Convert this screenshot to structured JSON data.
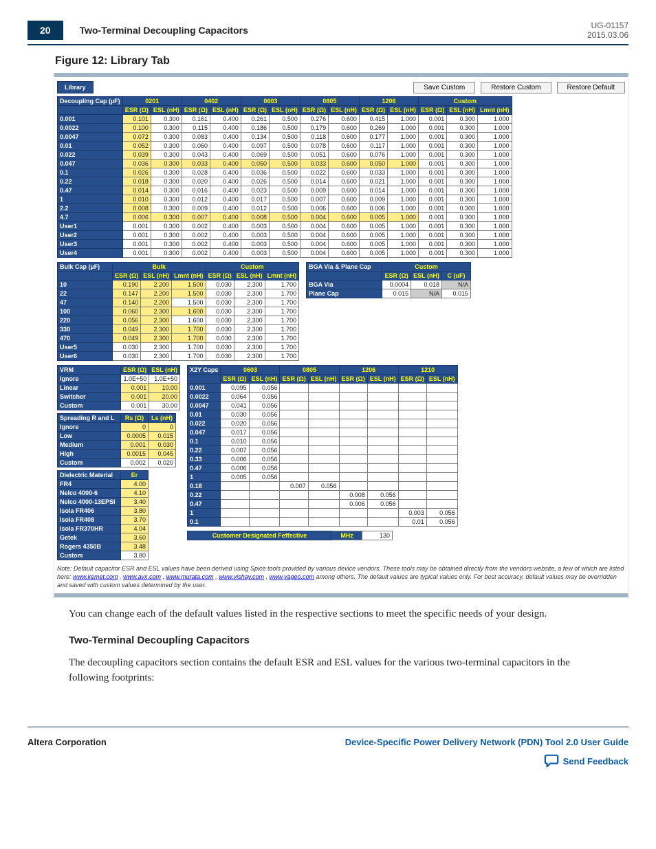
{
  "doc": {
    "id": "UG-01157",
    "date": "2015.03.06",
    "page": "20"
  },
  "header": {
    "section": "Two-Terminal Decoupling Capacitors"
  },
  "figure": {
    "caption": "Figure 12: Library Tab",
    "tab": "Library",
    "buttons": {
      "save": "Save Custom",
      "restore": "Restore Custom",
      "default": "Restore Default"
    }
  },
  "decoupling": {
    "title": "Decoupling Cap (µF)",
    "groups": [
      "0201",
      "0402",
      "0603",
      "0805",
      "1206",
      "Custom"
    ],
    "cols": [
      "ESR (Ω)",
      "ESL (nH)",
      "ESR (Ω)",
      "ESL (nH)",
      "ESR (Ω)",
      "ESL (nH)",
      "ESR (Ω)",
      "ESL (nH)",
      "ESR (Ω)",
      "ESL (nH)",
      "ESR (Ω)",
      "ESL (nH)",
      "Lmnt (nH)"
    ],
    "rows": [
      {
        "label": "0.001",
        "hl": [
          0
        ],
        "v": [
          "0.101",
          "0.300",
          "0.161",
          "0.400",
          "0.261",
          "0.500",
          "0.276",
          "0.600",
          "0.415",
          "1.000",
          "0.001",
          "0.300",
          "1.000"
        ]
      },
      {
        "label": "0.0022",
        "hl": [
          0
        ],
        "v": [
          "0.100",
          "0.300",
          "0.115",
          "0.400",
          "0.186",
          "0.500",
          "0.179",
          "0.600",
          "0.269",
          "1.000",
          "0.001",
          "0.300",
          "1.000"
        ]
      },
      {
        "label": "0.0047",
        "hl": [
          0
        ],
        "v": [
          "0.072",
          "0.300",
          "0.083",
          "0.400",
          "0.134",
          "0.500",
          "0.118",
          "0.600",
          "0.177",
          "1.000",
          "0.001",
          "0.300",
          "1.000"
        ]
      },
      {
        "label": "0.01",
        "hl": [
          0
        ],
        "v": [
          "0.052",
          "0.300",
          "0.060",
          "0.400",
          "0.097",
          "0.500",
          "0.078",
          "0.600",
          "0.117",
          "1.000",
          "0.001",
          "0.300",
          "1.000"
        ]
      },
      {
        "label": "0.022",
        "hl": [
          0
        ],
        "v": [
          "0.039",
          "0.300",
          "0.043",
          "0.400",
          "0.069",
          "0.500",
          "0.051",
          "0.600",
          "0.076",
          "1.000",
          "0.001",
          "0.300",
          "1.000"
        ]
      },
      {
        "label": "0.047",
        "hl": [
          0,
          1,
          2,
          3,
          4,
          5,
          6,
          7,
          8,
          9
        ],
        "v": [
          "0.036",
          "0.300",
          "0.033",
          "0.400",
          "0.050",
          "0.500",
          "0.033",
          "0.600",
          "0.050",
          "1.000",
          "0.001",
          "0.300",
          "1.000"
        ]
      },
      {
        "label": "0.1",
        "hl": [
          0
        ],
        "v": [
          "0.026",
          "0.300",
          "0.028",
          "0.400",
          "0.036",
          "0.500",
          "0.022",
          "0.600",
          "0.033",
          "1.000",
          "0.001",
          "0.300",
          "1.000"
        ]
      },
      {
        "label": "0.22",
        "hl": [
          0
        ],
        "v": [
          "0.018",
          "0.300",
          "0.020",
          "0.400",
          "0.026",
          "0.500",
          "0.014",
          "0.600",
          "0.021",
          "1.000",
          "0.001",
          "0.300",
          "1.000"
        ]
      },
      {
        "label": "0.47",
        "hl": [
          0
        ],
        "v": [
          "0.014",
          "0.300",
          "0.016",
          "0.400",
          "0.023",
          "0.500",
          "0.009",
          "0.600",
          "0.014",
          "1.000",
          "0.001",
          "0.300",
          "1.000"
        ]
      },
      {
        "label": "1",
        "hl": [
          0
        ],
        "v": [
          "0.010",
          "0.300",
          "0.012",
          "0.400",
          "0.017",
          "0.500",
          "0.007",
          "0.600",
          "0.009",
          "1.000",
          "0.001",
          "0.300",
          "1.000"
        ]
      },
      {
        "label": "2.2",
        "hl": [
          0
        ],
        "v": [
          "0.008",
          "0.300",
          "0.009",
          "0.400",
          "0.012",
          "0.500",
          "0.006",
          "0.600",
          "0.006",
          "1.000",
          "0.001",
          "0.300",
          "1.000"
        ]
      },
      {
        "label": "4.7",
        "hl": [
          0,
          1,
          2,
          3,
          4,
          5,
          6,
          7,
          8,
          9
        ],
        "v": [
          "0.006",
          "0.300",
          "0.007",
          "0.400",
          "0.008",
          "0.500",
          "0.004",
          "0.600",
          "0.005",
          "1.000",
          "0.001",
          "0.300",
          "1.000"
        ]
      },
      {
        "label": "User1",
        "v": [
          "0.001",
          "0.300",
          "0.002",
          "0.400",
          "0.003",
          "0.500",
          "0.004",
          "0.600",
          "0.005",
          "1.000",
          "0.001",
          "0.300",
          "1.000"
        ]
      },
      {
        "label": "User2",
        "v": [
          "0.001",
          "0.300",
          "0.002",
          "0.400",
          "0.003",
          "0.500",
          "0.004",
          "0.600",
          "0.005",
          "1.000",
          "0.001",
          "0.300",
          "1.000"
        ]
      },
      {
        "label": "User3",
        "v": [
          "0.001",
          "0.300",
          "0.002",
          "0.400",
          "0.003",
          "0.500",
          "0.004",
          "0.600",
          "0.005",
          "1.000",
          "0.001",
          "0.300",
          "1.000"
        ]
      },
      {
        "label": "User4",
        "v": [
          "0.001",
          "0.300",
          "0.002",
          "0.400",
          "0.003",
          "0.500",
          "0.004",
          "0.600",
          "0.005",
          "1.000",
          "0.001",
          "0.300",
          "1.000"
        ]
      }
    ]
  },
  "bulk": {
    "title": "Bulk Cap (µF)",
    "groups": [
      "Bulk",
      "Custom"
    ],
    "cols": [
      "ESR (Ω)",
      "ESL (nH)",
      "Lmnt (nH)",
      "ESR (Ω)",
      "ESL (nH)",
      "Lmnt (nH)"
    ],
    "rows": [
      {
        "label": "10",
        "hl": [
          0,
          1,
          2
        ],
        "v": [
          "0.190",
          "2.200",
          "1.500",
          "0.030",
          "2.300",
          "1.700"
        ]
      },
      {
        "label": "22",
        "hl": [
          0,
          1,
          2
        ],
        "v": [
          "0.147",
          "2.200",
          "1.500",
          "0.030",
          "2.300",
          "1.700"
        ]
      },
      {
        "label": "47",
        "hl": [
          0,
          1
        ],
        "v": [
          "0.140",
          "2.200",
          "1.500",
          "0.030",
          "2.300",
          "1.700"
        ]
      },
      {
        "label": "100",
        "hl": [
          0,
          1,
          2
        ],
        "v": [
          "0.060",
          "2.300",
          "1.600",
          "0.030",
          "2.300",
          "1.700"
        ]
      },
      {
        "label": "220",
        "hl": [
          0,
          1
        ],
        "v": [
          "0.056",
          "2.300",
          "1.600",
          "0.030",
          "2.300",
          "1.700"
        ]
      },
      {
        "label": "330",
        "hl": [
          0,
          1,
          2
        ],
        "v": [
          "0.049",
          "2.300",
          "1.700",
          "0.030",
          "2.300",
          "1.700"
        ]
      },
      {
        "label": "470",
        "hl": [
          0,
          1,
          2
        ],
        "v": [
          "0.049",
          "2.300",
          "1.700",
          "0.030",
          "2.300",
          "1.700"
        ]
      },
      {
        "label": "User5",
        "v": [
          "0.030",
          "2.300",
          "1.700",
          "0.030",
          "2.300",
          "1.700"
        ]
      },
      {
        "label": "User6",
        "v": [
          "0.030",
          "2.300",
          "1.700",
          "0.030",
          "2.300",
          "1.700"
        ]
      }
    ]
  },
  "bga": {
    "title": "BGA Via & Plane Cap",
    "group": "Custom",
    "cols": [
      "ESR (Ω)",
      "ESL (nH)",
      "C (uF)"
    ],
    "rows": [
      {
        "label": "BGA Via",
        "v": [
          "0.0004",
          "0.018",
          "N/A"
        ]
      },
      {
        "label": "Plane Cap",
        "v": [
          "0.015",
          "N/A",
          "0.015"
        ]
      }
    ]
  },
  "vrm": {
    "title": "VRM",
    "cols": [
      "ESR (Ω)",
      "ESL (nH)"
    ],
    "rows": [
      {
        "label": "Ignore",
        "v": [
          "1.0E+50",
          "1.0E+50"
        ]
      },
      {
        "label": "Linear",
        "hl": [
          0,
          1
        ],
        "v": [
          "0.001",
          "10.00"
        ]
      },
      {
        "label": "Switcher",
        "hl": [
          0,
          1
        ],
        "v": [
          "0.001",
          "20.00"
        ]
      },
      {
        "label": "Custom",
        "v": [
          "0.001",
          "30.00"
        ]
      }
    ]
  },
  "spread": {
    "title": "Spreading R and L",
    "cols": [
      "Rs (Ω)",
      "Ls (nH)"
    ],
    "rows": [
      {
        "label": "Ignore",
        "hl": [
          0,
          1
        ],
        "v": [
          "0",
          "0"
        ]
      },
      {
        "label": "Low",
        "hl": [
          0,
          1
        ],
        "v": [
          "0.0005",
          "0.015"
        ]
      },
      {
        "label": "Medium",
        "hl": [
          0,
          1
        ],
        "v": [
          "0.001",
          "0.030"
        ]
      },
      {
        "label": "High",
        "hl": [
          0,
          1
        ],
        "v": [
          "0.0015",
          "0.045"
        ]
      },
      {
        "label": "Custom",
        "v": [
          "0.002",
          "0.020"
        ]
      }
    ]
  },
  "dielectric": {
    "title": "Dielectric Material",
    "cols": [
      "Er"
    ],
    "rows": [
      {
        "label": "FR4",
        "hl": [
          0
        ],
        "v": [
          "4.00"
        ]
      },
      {
        "label": "Nelco 4000-6",
        "hl": [
          0
        ],
        "v": [
          "4.10"
        ]
      },
      {
        "label": "Nelco 4000-13EPSI",
        "hl": [
          0
        ],
        "v": [
          "3.40"
        ]
      },
      {
        "label": "Isola FR406",
        "hl": [
          0
        ],
        "v": [
          "3.80"
        ]
      },
      {
        "label": "Isola FR408",
        "hl": [
          0
        ],
        "v": [
          "3.70"
        ]
      },
      {
        "label": "Isola FR370HR",
        "hl": [
          0
        ],
        "v": [
          "4.04"
        ]
      },
      {
        "label": "Getek",
        "hl": [
          0
        ],
        "v": [
          "3.60"
        ]
      },
      {
        "label": "Rogers 4350B",
        "hl": [
          0
        ],
        "v": [
          "3.48"
        ]
      },
      {
        "label": "Custom",
        "v": [
          "3.80"
        ]
      }
    ]
  },
  "x2y": {
    "title": "X2Y Caps",
    "groups": [
      "0603",
      "0805",
      "1206",
      "1210"
    ],
    "cols": [
      "ESR (Ω)",
      "ESL (nH)",
      "ESR (Ω)",
      "ESL (nH)",
      "ESR (Ω)",
      "ESL (nH)",
      "ESR (Ω)",
      "ESL (nH)"
    ],
    "rows": [
      {
        "label": "0.001",
        "v": [
          "0.095",
          "0.056",
          "",
          "",
          "",
          "",
          "",
          ""
        ]
      },
      {
        "label": "0.0022",
        "v": [
          "0.064",
          "0.056",
          "",
          "",
          "",
          "",
          "",
          ""
        ]
      },
      {
        "label": "0.0047",
        "v": [
          "0.041",
          "0.056",
          "",
          "",
          "",
          "",
          "",
          ""
        ]
      },
      {
        "label": "0.01",
        "v": [
          "0.030",
          "0.056",
          "",
          "",
          "",
          "",
          "",
          ""
        ]
      },
      {
        "label": "0.022",
        "v": [
          "0.020",
          "0.056",
          "",
          "",
          "",
          "",
          "",
          ""
        ]
      },
      {
        "label": "0.047",
        "v": [
          "0.017",
          "0.056",
          "",
          "",
          "",
          "",
          "",
          ""
        ]
      },
      {
        "label": "0.1",
        "v": [
          "0.010",
          "0.056",
          "",
          "",
          "",
          "",
          "",
          ""
        ]
      },
      {
        "label": "0.22",
        "v": [
          "0.007",
          "0.056",
          "",
          "",
          "",
          "",
          "",
          ""
        ]
      },
      {
        "label": "0.33",
        "v": [
          "0.006",
          "0.056",
          "",
          "",
          "",
          "",
          "",
          ""
        ]
      },
      {
        "label": "0.47",
        "v": [
          "0.006",
          "0.056",
          "",
          "",
          "",
          "",
          "",
          ""
        ]
      },
      {
        "label": "1",
        "v": [
          "0.005",
          "0.056",
          "",
          "",
          "",
          "",
          "",
          ""
        ]
      },
      {
        "label": "0.18",
        "v": [
          "",
          "",
          "0.007",
          "0.056",
          "",
          "",
          "",
          ""
        ]
      },
      {
        "label": "0.22",
        "v": [
          "",
          "",
          "",
          "",
          "0.008",
          "0.056",
          "",
          ""
        ]
      },
      {
        "label": "0.47",
        "v": [
          "",
          "",
          "",
          "",
          "0.006",
          "0.056",
          "",
          ""
        ]
      },
      {
        "label": "1",
        "v": [
          "",
          "",
          "",
          "",
          "",
          "",
          "0.003",
          "0.056"
        ]
      },
      {
        "label": "0.1",
        "v": [
          "",
          "",
          "",
          "",
          "",
          "",
          "0.01",
          "0.056"
        ]
      }
    ],
    "feff": {
      "label": "Customer Designated Feffective",
      "unit": "MHz",
      "value": "130"
    }
  },
  "note": {
    "text1": "Note:  Default capacitor ESR and ESL values have been derived using Spice tools provided by various device vendors. These tools may be obtained directly from the vendors website, a few of which are listed here: ",
    "links": [
      "www.kemet.com",
      "www.avx.com",
      "www.murata.com",
      "www.vishay.com",
      "www.yageo.com"
    ],
    "text2": " among others. The default values are typical values only. For best accuracy, default values may be overridden and saved with custom values determined by the user."
  },
  "body": {
    "p1": "You can change each of the default values listed in the respective sections to meet the specific needs of your design.",
    "h": "Two-Terminal Decoupling Capacitors",
    "p2": "The decoupling capacitors section contains the default ESR and ESL values for the various two-terminal capacitors in the following footprints:"
  },
  "footer": {
    "left": "Altera Corporation",
    "right": "Device-Specific Power Delivery Network (PDN) Tool 2.0 User Guide",
    "feedback": "Send Feedback"
  }
}
